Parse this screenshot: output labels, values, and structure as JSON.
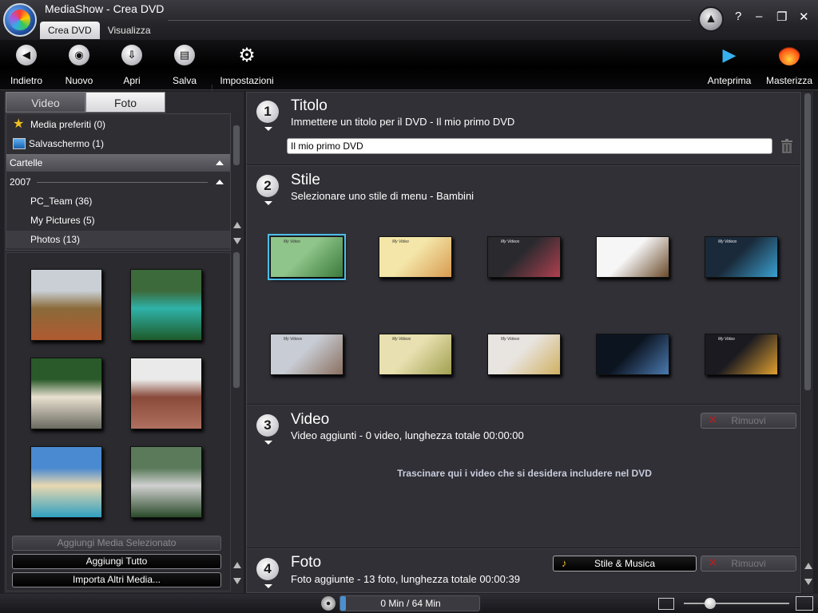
{
  "window": {
    "title": "MediaShow - Crea DVD",
    "controls": [
      "?",
      "–",
      "❐",
      "✕"
    ]
  },
  "menu_tabs": [
    {
      "label": "Crea DVD",
      "active": true
    },
    {
      "label": "Visualizza",
      "active": false
    }
  ],
  "toolbar": {
    "left": [
      {
        "label": "Indietro",
        "icon": "back-icon"
      },
      {
        "label": "Nuovo",
        "icon": "disc-new-icon"
      },
      {
        "label": "Apri",
        "icon": "open-icon"
      },
      {
        "label": "Salva",
        "icon": "save-icon"
      },
      {
        "label": "Impostazioni",
        "icon": "gear-icon"
      }
    ],
    "right": [
      {
        "label": "Anteprima",
        "icon": "play-icon"
      },
      {
        "label": "Masterizza",
        "icon": "burn-icon"
      }
    ]
  },
  "source_tabs": [
    {
      "label": "Video",
      "active": false
    },
    {
      "label": "Foto",
      "active": true
    }
  ],
  "tree": {
    "favorites": "Media preferiti (0)",
    "screensaver": "Salvaschermo (1)",
    "folders_header": "Cartelle",
    "year": "2007",
    "folders": [
      "PC_Team (36)",
      "My Pictures (5)",
      "Photos (13)"
    ],
    "selected_folder": "Photos (13)"
  },
  "photos": [
    {
      "name": "dam-landscape",
      "colors": [
        "#c9cfd4",
        "#8a6a3a",
        "#b05a30"
      ]
    },
    {
      "name": "lake-green",
      "colors": [
        "#3c6a3a",
        "#2fb2a8",
        "#1e5a2a"
      ]
    },
    {
      "name": "two-dogs",
      "colors": [
        "#2a5a2a",
        "#e8e0d0",
        "#6a6a60"
      ]
    },
    {
      "name": "brick-arches",
      "colors": [
        "#eaeaea",
        "#8a4a3a",
        "#b07060"
      ]
    },
    {
      "name": "beach-boats",
      "colors": [
        "#4a8ad0",
        "#e8d8b0",
        "#30a0c0"
      ]
    },
    {
      "name": "suspension-bridge",
      "colors": [
        "#5a7a5a",
        "#d0d0d0",
        "#2a4a2a"
      ]
    }
  ],
  "left_buttons": {
    "add_selected": "Aggiungi Media Selezionato",
    "add_all": "Aggiungi Tutto",
    "import_more": "Importa Altri Media..."
  },
  "sections": {
    "title": {
      "number": "1",
      "heading": "Titolo",
      "subtitle": "Immettere un titolo per il DVD - Il mio primo DVD",
      "input_value": "Il mio primo DVD"
    },
    "style": {
      "number": "2",
      "heading": "Stile",
      "subtitle": "Selezionare uno stile di menu - Bambini",
      "styles": [
        {
          "name": "style-green-board",
          "bg": "#8fc48a",
          "accent": "#3a7a3a",
          "caption": "My Video",
          "selected": true
        },
        {
          "name": "style-bunny",
          "bg": "#f4e6a8",
          "accent": "#d89a50",
          "caption": "My Video",
          "selected": false
        },
        {
          "name": "style-dark-film",
          "bg": "#2a2a2e",
          "accent": "#b04050",
          "caption": "My Videos",
          "selected": false
        },
        {
          "name": "style-brush",
          "bg": "#f6f6f6",
          "accent": "#6a4a2a",
          "caption": "",
          "selected": false
        },
        {
          "name": "style-baby-blue",
          "bg": "#1a2a3a",
          "accent": "#3aa0d0",
          "caption": "My Videos",
          "selected": false
        },
        {
          "name": "style-silver-couple",
          "bg": "#c8ccd4",
          "accent": "#8a7060",
          "caption": "My Videos",
          "selected": false
        },
        {
          "name": "style-gold-couple",
          "bg": "#e8e0b0",
          "accent": "#a0a050",
          "caption": "My Videos",
          "selected": false
        },
        {
          "name": "style-wedding",
          "bg": "#e8e4e0",
          "accent": "#d0b060",
          "caption": "My Videos",
          "selected": false
        },
        {
          "name": "style-dark-blue",
          "bg": "#0c1420",
          "accent": "#4a7ab0",
          "caption": "",
          "selected": false
        },
        {
          "name": "style-sunset",
          "bg": "#1a1a20",
          "accent": "#e0a030",
          "caption": "My Video",
          "selected": false
        }
      ]
    },
    "video": {
      "number": "3",
      "heading": "Video",
      "subtitle": "Video aggiunti - 0 video, lunghezza totale 00:00:00",
      "remove_label": "Rimuovi",
      "drop_hint": "Trascinare qui i video che si desidera includere nel DVD"
    },
    "photo": {
      "number": "4",
      "heading": "Foto",
      "subtitle": "Foto aggiunte - 13 foto, lunghezza totale 00:00:39",
      "music_label": "Stile & Musica",
      "remove_label": "Rimuovi"
    }
  },
  "status": {
    "capacity_text": "0 Min / 64 Min",
    "capacity_fraction": 0.04,
    "zoom_fraction": 0.25
  }
}
